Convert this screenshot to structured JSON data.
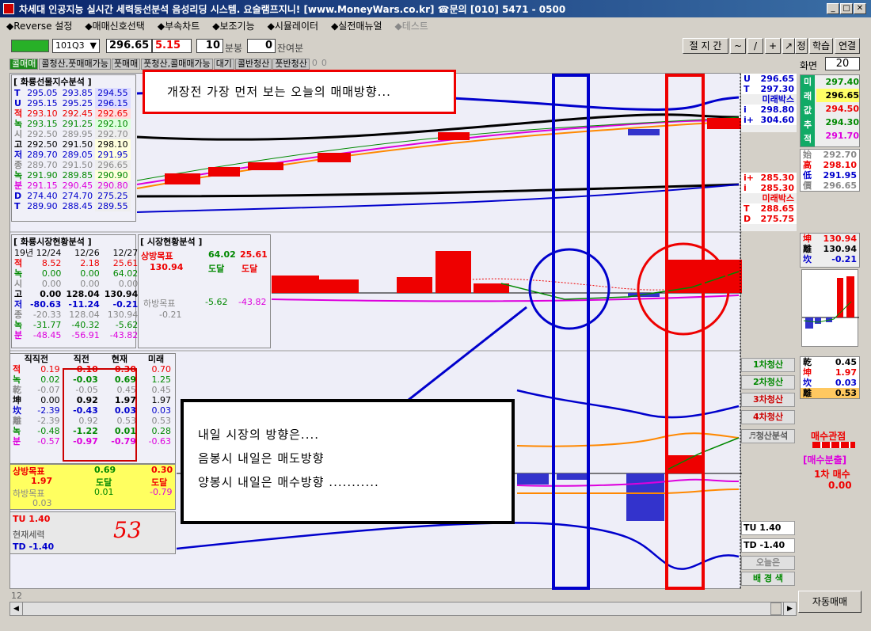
{
  "window": {
    "title": "차세대 인공지능 실시간 세력동선분석 음성리딩 시스템. 요술램프지니! [www.MoneyWars.co.kr] ☎문의 [010] 5471 - 0500"
  },
  "menu": [
    "◆Reverse 설정",
    "◆매매신호선택",
    "◆부속차트",
    "◆보조기능",
    "◆시뮬레이터",
    "◆실전매뉴얼",
    "◆테스트"
  ],
  "toolbar": {
    "code": "101Q3",
    "price": "296.65",
    "change": "5.15",
    "minutes": "10",
    "minutes_unit": "분봉",
    "rest": "0",
    "rest_unit": "잔여분",
    "buttons": [
      "절 지 간",
      "~",
      "/",
      "+",
      "↗",
      "정",
      "학습",
      "연결"
    ],
    "screen_label": "화면",
    "screen_value": "20"
  },
  "tabs": [
    "콜매매",
    "콜청산,풋매매가능",
    "풋매매",
    "풋청산,콜매매가능",
    "대기",
    "콜반청산",
    "풋반청산",
    "0",
    "0"
  ],
  "futures_panel": {
    "title": "[ 화룡선물지수분석 ]",
    "rows": [
      [
        "T",
        "295.05",
        "293.85",
        "294.55"
      ],
      [
        "U",
        "295.15",
        "295.25",
        "296.15"
      ],
      [
        "적",
        "293.10",
        "292.45",
        "292.65"
      ],
      [
        "녹",
        "293.15",
        "291.25",
        "292.10"
      ],
      [
        "시",
        "292.50",
        "289.95",
        "292.70"
      ],
      [
        "고",
        "292.50",
        "291.50",
        "298.10"
      ],
      [
        "저",
        "289.70",
        "289.05",
        "291.95"
      ],
      [
        "종",
        "289.70",
        "291.50",
        "296.65"
      ],
      [
        "녹",
        "291.90",
        "289.85",
        "290.90"
      ],
      [
        "분",
        "291.15",
        "290.45",
        "290.80"
      ],
      [
        "D",
        "274.40",
        "274.70",
        "275.25"
      ],
      [
        "T",
        "289.90",
        "288.45",
        "289.55"
      ]
    ]
  },
  "market_panel": {
    "title": "[ 화룡시장현황분석 ]",
    "headers": [
      "19년 12/24",
      "12/26",
      "12/27"
    ],
    "rows": [
      [
        "적",
        "8.52",
        "2.18",
        "25.61"
      ],
      [
        "녹",
        "0.00",
        "0.00",
        "64.02"
      ],
      [
        "시",
        "0.00",
        "0.00",
        "0.00"
      ],
      [
        "고",
        "0.00",
        "128.04",
        "130.94"
      ],
      [
        "저",
        "-80.63",
        "-11.24",
        "-0.21"
      ],
      [
        "종",
        "-20.33",
        "128.04",
        "130.94"
      ],
      [
        "녹",
        "-31.77",
        "-40.32",
        "-5.62"
      ],
      [
        "분",
        "-48.45",
        "-56.91",
        "-43.82"
      ]
    ]
  },
  "status_panel": {
    "title": "[ 시장현황분석 ]",
    "up_target": "상방목표",
    "up1": "64.02",
    "up2": "25.61",
    "up_val": "130.94",
    "reach1": "도달",
    "reach2": "도달",
    "down_target": "하방목표",
    "down1": "-5.62",
    "down2": "-43.82",
    "down_val": "-0.21"
  },
  "flow_panel": {
    "headers": [
      "직직전",
      "직전",
      "현재",
      "미래"
    ],
    "rows": [
      [
        "적",
        "0.19",
        "0.10",
        "0.30",
        "0.70"
      ],
      [
        "녹",
        "0.02",
        "-0.03",
        "0.69",
        "1.25"
      ],
      [
        "乾",
        "-0.07",
        "-0.05",
        "0.45",
        "0.45"
      ],
      [
        "坤",
        "0.00",
        "0.92",
        "1.97",
        "1.97"
      ],
      [
        "坎",
        "-2.39",
        "-0.43",
        "0.03",
        "0.03"
      ],
      [
        "離",
        "-2.39",
        "0.92",
        "0.53",
        "0.53"
      ],
      [
        "녹",
        "-0.48",
        "-1.22",
        "0.01",
        "0.28"
      ],
      [
        "분",
        "-0.57",
        "-0.97",
        "-0.79",
        "-0.63"
      ]
    ],
    "up_target": "상방목표",
    "up_a": "1.97",
    "up_b": "0.69",
    "up_c": "0.30",
    "reach1": "도달",
    "reach2": "도달",
    "down_target": "하방목표",
    "down_a": "0.03",
    "down_b": "0.01",
    "down_c": "-0.79",
    "tu": "TU  1.40",
    "power_label": "현재세력",
    "power": "53",
    "td": "TD -1.40"
  },
  "right_top": {
    "rows": [
      [
        "U",
        "296.65"
      ],
      [
        "T",
        "297.30"
      ],
      [
        "",
        "미래박스"
      ],
      [
        "i",
        "298.80"
      ],
      [
        "i+",
        "304.60"
      ]
    ],
    "rows2": [
      [
        "i+",
        "285.30"
      ],
      [
        "i",
        "285.30"
      ],
      [
        "",
        "미래박스"
      ],
      [
        "T",
        "288.65"
      ],
      [
        "D",
        "275.75"
      ]
    ]
  },
  "right_side": {
    "labels": [
      "미",
      "래",
      "값",
      "추",
      "적"
    ],
    "values": [
      "297.40",
      "296.65",
      "294.50",
      "294.30",
      "291.70"
    ],
    "rows": [
      [
        "始",
        "292.70"
      ],
      [
        "高",
        "298.10"
      ],
      [
        "低",
        "291.95"
      ],
      [
        "價",
        "296.65"
      ]
    ]
  },
  "right_mid": {
    "rows": [
      [
        "坤",
        "130.94"
      ],
      [
        "離",
        "130.94"
      ],
      [
        "坎",
        "-0.21"
      ]
    ]
  },
  "right_bottom": {
    "buttons": [
      "1차청산",
      "2차청산",
      "3차청산",
      "4차청산",
      "♬청산분석"
    ],
    "tu": "TU   1.40",
    "td": "TD  -1.40",
    "today": "오늘은",
    "bg": "배 경 색"
  },
  "right_bottom2": {
    "rows": [
      [
        "乾",
        "0.45"
      ],
      [
        "坤",
        "1.97"
      ],
      [
        "坎",
        "0.03"
      ],
      [
        "離",
        "0.53"
      ]
    ],
    "watch": "매수관점",
    "split": "[매수분출]",
    "first": "1차 매수",
    "first_val": "0.00"
  },
  "annotations": {
    "top": "개장전 가장 먼저 보는 오늘의 매매방향...",
    "l1": "내일 시장의 방향은....",
    "l2": "음봉시 내일은 매도방향",
    "l3": "양봉시 내일은 매수방향 ..........."
  },
  "bottom": {
    "page": "12",
    "auto": "자동매매"
  }
}
